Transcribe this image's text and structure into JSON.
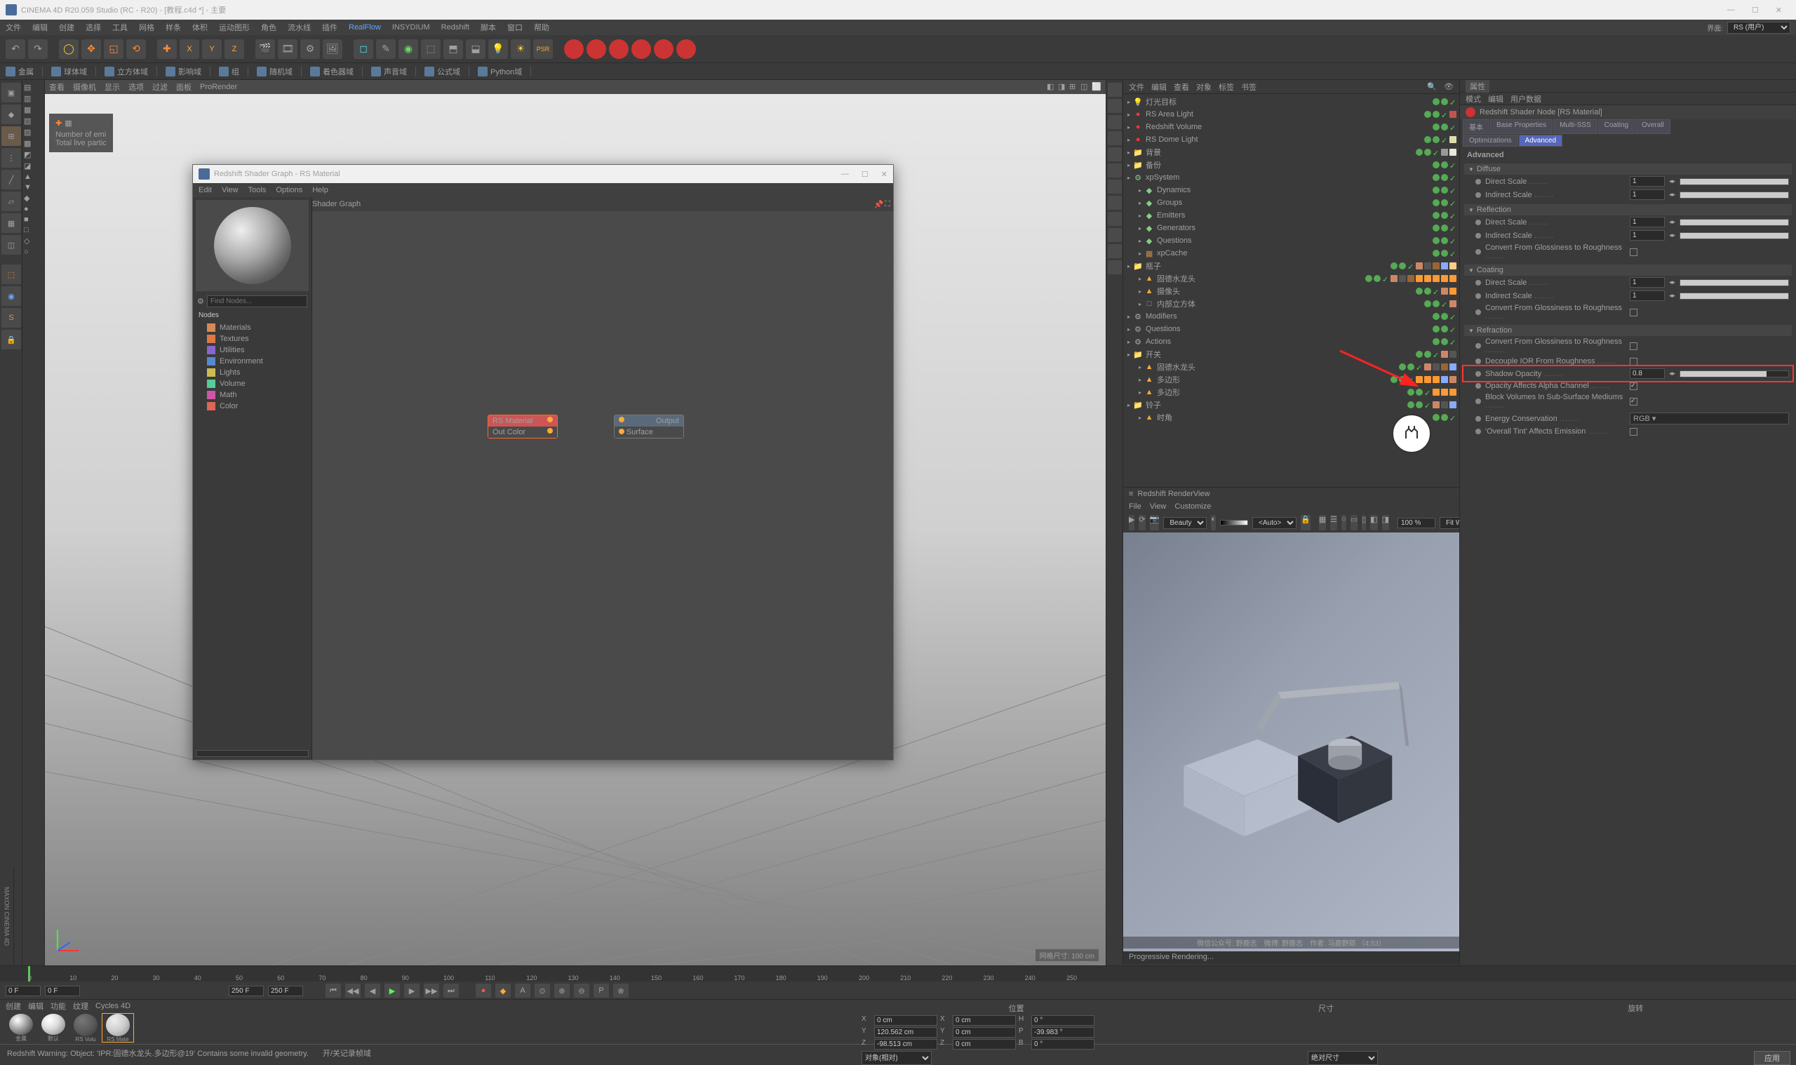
{
  "app": {
    "title": "CINEMA 4D R20.059 Studio (RC - R20) - [教程.c4d *] - 主要",
    "win_min": "—",
    "win_max": "☐",
    "win_close": "✕"
  },
  "menubar": [
    "文件",
    "编辑",
    "创建",
    "选择",
    "工具",
    "网格",
    "样条",
    "体积",
    "运动图形",
    "角色",
    "流水线",
    "插件",
    "RealFlow",
    "INSYDIUM",
    "Redshift",
    "脚本",
    "窗口",
    "帮助"
  ],
  "layout": {
    "label": "界面:",
    "value": "RS (用户)"
  },
  "toolbar_primary": [
    "撤销",
    "重做",
    null,
    "移动",
    "缩放",
    "旋转",
    "实时选择",
    null,
    "加",
    "轴X",
    "轴Y",
    "轴Z",
    null,
    "相机",
    "渲染",
    "渲染设置",
    "渲染队列",
    null,
    "立方体",
    "画笔",
    "细分",
    "地面",
    "灯",
    "摄像机",
    "样条",
    "阵列",
    "PSR",
    null,
    "R1",
    "R2",
    "R3",
    "R4",
    "R5",
    "R6"
  ],
  "toolbar_groups": [
    "金属",
    "球体域",
    "立方体域",
    "影响域",
    "组",
    "随机域",
    "着色器域",
    "声音域",
    "公式域",
    "Python域"
  ],
  "viewport_tabs": [
    "查看",
    "摄像机",
    "显示",
    "选项",
    "过滤",
    "面板",
    "ProRender"
  ],
  "hud": {
    "l1": "Number of emi",
    "l2": "Total live partic"
  },
  "shader_window": {
    "title": "Redshift Shader Graph - RS Material",
    "menu": [
      "Edit",
      "View",
      "Tools",
      "Options",
      "Help"
    ],
    "find_placeholder": "Find Nodes...",
    "nodes_header": "Nodes",
    "categories": [
      {
        "name": "Materials",
        "color": "#d88855"
      },
      {
        "name": "Textures",
        "color": "#dd7744"
      },
      {
        "name": "Utilities",
        "color": "#8866cc"
      },
      {
        "name": "Environment",
        "color": "#5588cc"
      },
      {
        "name": "Lights",
        "color": "#ccbb55"
      },
      {
        "name": "Volume",
        "color": "#55cc99"
      },
      {
        "name": "Math",
        "color": "#cc55aa"
      },
      {
        "name": "Color",
        "color": "#dd6655"
      }
    ],
    "canvas_title": "Shader Graph",
    "node_rs": {
      "title": "RS Material",
      "out": "Out Color"
    },
    "node_out": {
      "title": "Output",
      "in": "Surface"
    }
  },
  "objects": {
    "tabs": [
      "文件",
      "编辑",
      "查看",
      "对象",
      "标签",
      "书签"
    ],
    "items": [
      {
        "d": 0,
        "ico": "💡",
        "c": "#ff6633",
        "name": "灯光目标"
      },
      {
        "d": 0,
        "ico": "●",
        "c": "#ff3333",
        "name": "RS Area Light",
        "tags": [
          "#c0544f"
        ]
      },
      {
        "d": 0,
        "ico": "●",
        "c": "#ff3333",
        "name": "Redshift Volume"
      },
      {
        "d": 0,
        "ico": "●",
        "c": "#ff3333",
        "name": "RS Dome Light",
        "tags": [
          "#ddddb0"
        ]
      },
      {
        "d": 0,
        "ico": "📁",
        "c": "#66ccff",
        "name": "背景",
        "tags": [
          "#999",
          "#e8e8d8"
        ]
      },
      {
        "d": 0,
        "ico": "📁",
        "c": "#66ccff",
        "name": "备份"
      },
      {
        "d": 0,
        "ico": "⚙",
        "c": "#88cc88",
        "name": "xpSystem"
      },
      {
        "d": 1,
        "ico": "◆",
        "c": "#88cc88",
        "name": "Dynamics"
      },
      {
        "d": 1,
        "ico": "◆",
        "c": "#88cc88",
        "name": "Groups"
      },
      {
        "d": 1,
        "ico": "◆",
        "c": "#88cc88",
        "name": "Emitters"
      },
      {
        "d": 1,
        "ico": "◆",
        "c": "#88cc88",
        "name": "Generators"
      },
      {
        "d": 1,
        "ico": "◆",
        "c": "#88cc88",
        "name": "Questions"
      },
      {
        "d": 1,
        "ico": "▦",
        "c": "#cc8844",
        "name": "xpCache"
      },
      {
        "d": 0,
        "ico": "📁",
        "c": "#66ccff",
        "name": "瓶子",
        "tags": [
          "#c86",
          "#555",
          "#963",
          "#8af",
          "#fc8"
        ]
      },
      {
        "d": 1,
        "ico": "▲",
        "c": "#ffaa33",
        "name": "固德水龙头",
        "tags": [
          "#c86",
          "#555",
          "#963",
          "#f93",
          "#f93",
          "#f93",
          "#f93",
          "#f93"
        ]
      },
      {
        "d": 1,
        "ico": "▲",
        "c": "#ffaa33",
        "name": "摄像头",
        "tags": [
          "#c86",
          "#f93"
        ]
      },
      {
        "d": 1,
        "ico": "□",
        "c": "#88aacc",
        "name": "内部立方体",
        "tags": [
          "#c86"
        ]
      },
      {
        "d": 0,
        "ico": "⚙",
        "c": "#aaaaaa",
        "name": "Modifiers"
      },
      {
        "d": 0,
        "ico": "⚙",
        "c": "#aaaaaa",
        "name": "Questions"
      },
      {
        "d": 0,
        "ico": "⚙",
        "c": "#aaaaaa",
        "name": "Actions"
      },
      {
        "d": 0,
        "ico": "📁",
        "c": "#66ccff",
        "name": "开关",
        "tags": [
          "#c86",
          "#555"
        ]
      },
      {
        "d": 1,
        "ico": "▲",
        "c": "#ffaa33",
        "name": "固德水龙头",
        "tags": [
          "#c86",
          "#555",
          "#963",
          "#8af"
        ]
      },
      {
        "d": 1,
        "ico": "▲",
        "c": "#ffaa33",
        "name": "多边形",
        "tags": [
          "#f93",
          "#f93",
          "#f93",
          "#8af",
          "#c86"
        ]
      },
      {
        "d": 1,
        "ico": "▲",
        "c": "#ffaa33",
        "name": "多边形",
        "tags": [
          "#f93",
          "#f93",
          "#f93"
        ]
      },
      {
        "d": 0,
        "ico": "📁",
        "c": "#66ccff",
        "name": "铃子",
        "tags": [
          "#c86",
          "#555",
          "#8af"
        ]
      },
      {
        "d": 1,
        "ico": "▲",
        "c": "#ffaa33",
        "name": "时角"
      }
    ]
  },
  "attributes": {
    "tab_top": "属性",
    "modes": [
      "模式",
      "编辑",
      "用户数据"
    ],
    "head": "Redshift Shader Node [RS Material]",
    "row1": [
      "基本",
      "Base Properties",
      "Multi-SSS",
      "Coating",
      "Overall"
    ],
    "row2": [
      "Optimizations",
      "Advanced"
    ],
    "adv_title": "Advanced",
    "sections": [
      {
        "title": "Diffuse",
        "rows": [
          {
            "label": "Direct Scale",
            "value": "1",
            "fill": 100
          },
          {
            "label": "Indirect Scale",
            "value": "1",
            "fill": 100
          }
        ]
      },
      {
        "title": "Reflection",
        "rows": [
          {
            "label": "Direct Scale",
            "value": "1",
            "fill": 100
          },
          {
            "label": "Indirect Scale",
            "value": "1",
            "fill": 100
          },
          {
            "label": "Convert From Glossiness to Roughness",
            "check": false
          }
        ]
      },
      {
        "title": "Coating",
        "rows": [
          {
            "label": "Direct Scale",
            "value": "1",
            "fill": 100
          },
          {
            "label": "Indirect Scale",
            "value": "1",
            "fill": 100
          },
          {
            "label": "Convert From Glossiness to Roughness",
            "check": false
          }
        ]
      },
      {
        "title": "Refraction",
        "rows": [
          {
            "label": "Convert From Glossiness to Roughness",
            "check": false
          },
          {
            "label": "Decouple IOR From Roughness",
            "check": false
          },
          {
            "label": "Shadow Opacity",
            "value": "0.8",
            "fill": 80,
            "highlight": true
          },
          {
            "label": "Opacity Affects Alpha Channel",
            "check": true
          },
          {
            "label": "Block Volumes In Sub-Surface Mediums",
            "check": true
          },
          {
            "label": "Energy Conservation",
            "select": "RGB"
          },
          {
            "label": "'Overall Tint' Affects Emission",
            "check": false
          }
        ]
      }
    ]
  },
  "renderview": {
    "title": "Redshift RenderView",
    "menu": [
      "File",
      "View",
      "Customize"
    ],
    "beauty": "Beauty",
    "auto": "<Auto>",
    "zoom": "100 %",
    "fit": "Fit Window",
    "overlay": "微信公众号: 野鹿志　微博: 野鹿志　作者: 马鹿野郎 （4:53）",
    "status": "Progressive Rendering..."
  },
  "timeline": {
    "ticks": [
      0,
      10,
      20,
      30,
      40,
      50,
      60,
      70,
      80,
      90,
      100,
      110,
      120,
      130,
      140,
      150,
      160,
      170,
      180,
      190,
      200,
      210,
      220,
      230,
      240,
      250
    ],
    "start": "0 F",
    "cur": "0 F",
    "mid1": "250 F",
    "mid2": "250 F"
  },
  "materials": {
    "tabs": [
      "创建",
      "编辑",
      "功能",
      "纹理",
      "Cycles 4D"
    ],
    "slots": [
      {
        "name": "金属",
        "grad": "radial-gradient(circle at 35% 30%,#fff,#aaa 40%,#555 80%)"
      },
      {
        "name": "默认",
        "grad": "radial-gradient(circle at 35% 30%,#fff,#ddd 40%,#999 80%)"
      },
      {
        "name": "RS Volu",
        "grad": "radial-gradient(circle at 35% 30%,#777,#555 60%,#333)"
      },
      {
        "name": "RS Mate",
        "grad": "radial-gradient(circle at 35% 30%,#eee,#ccc 50%,#888)",
        "sel": true
      }
    ]
  },
  "coords": {
    "headers": [
      "位置",
      "尺寸",
      "旋转"
    ],
    "rows": [
      {
        "axis": "X",
        "p": "0 cm",
        "s": "0 cm",
        "r": "0 °",
        "rl": "H"
      },
      {
        "axis": "Y",
        "p": "120.562 cm",
        "s": "0 cm",
        "r": "-39.983 °",
        "rl": "P"
      },
      {
        "axis": "Z",
        "p": "-98.513 cm",
        "s": "0 cm",
        "r": "0 °",
        "rl": "B"
      }
    ],
    "mode1": "对象(相对)",
    "mode2": "绝对尺寸",
    "apply": "应用"
  },
  "status": {
    "l": "Redshift Warning: Object: 'IPR:固德水龙头.多边形@19' Contains some invalid geometry.",
    "r": "开/关记录帧域"
  },
  "maxon": "MAXON CINEMA 4D",
  "vp_size": "网格尺寸: 100 cm"
}
